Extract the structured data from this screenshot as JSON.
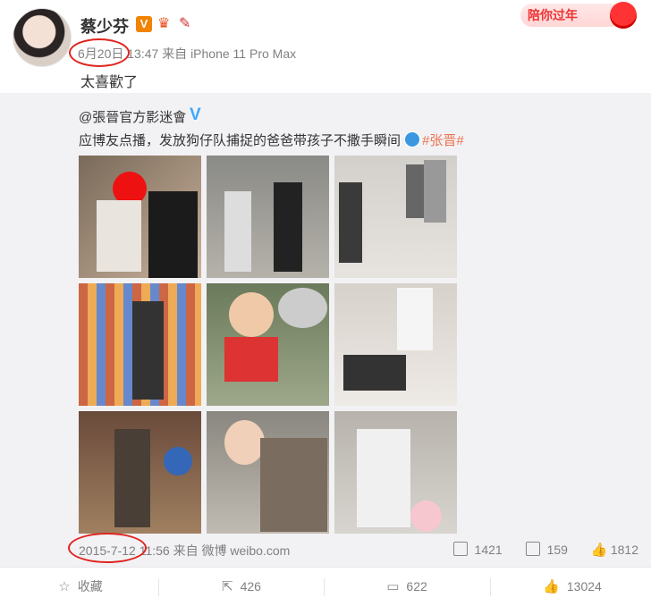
{
  "post": {
    "author": "蔡少芬",
    "date": "6月20日",
    "time": "13:47",
    "source": "来自 iPhone 11 Pro Max",
    "text": "太喜歡了",
    "vip_badge": "V",
    "event_badge": "陪你过年"
  },
  "repost": {
    "author": "@張晉官方影迷會",
    "text": "应博友点播，发放狗仔队捕捉的爸爸带孩子不撒手瞬间",
    "hashtag": "#张晋#",
    "date": "2015-7-12",
    "time": "11:56",
    "source": "来自 微博 weibo.com",
    "stats": {
      "reposts": "1421",
      "comments": "159",
      "likes": "1812"
    }
  },
  "actions": {
    "favorite": "收藏",
    "repost": "426",
    "comment": "622",
    "like": "13024"
  },
  "colors": {
    "accent_orange": "#eb7350",
    "blue_v": "#3ea7ff",
    "annotation_red": "#e0241e"
  }
}
